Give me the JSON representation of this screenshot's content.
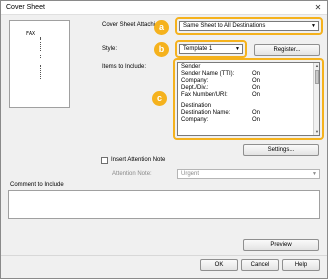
{
  "window": {
    "title": "Cover Sheet",
    "close_glyph": "✕"
  },
  "preview": {
    "fax_text": "FAX"
  },
  "cover_sheet_attachment": {
    "label": "Cover Sheet Attachi",
    "value": "Same Sheet to All Destinations"
  },
  "style": {
    "label": "Style:",
    "value": "Template 1",
    "register_label": "Register..."
  },
  "items_to_include": {
    "label": "Items to Include:",
    "rows": [
      {
        "name": "Sender",
        "value": ""
      },
      {
        "name": "Sender Name (TTI):",
        "value": "On"
      },
      {
        "name": "Company:",
        "value": "On"
      },
      {
        "name": "Dept./Div.:",
        "value": "On"
      },
      {
        "name": "Fax Number/URI:",
        "value": "On"
      },
      {
        "name": "",
        "value": ""
      },
      {
        "name": "Destination",
        "value": ""
      },
      {
        "name": "Destination Name:",
        "value": "On"
      },
      {
        "name": "Company:",
        "value": "On"
      }
    ],
    "settings_label": "Settings..."
  },
  "attention_note": {
    "checkbox_label": "Insert Attention Note",
    "field_label": "Attention Note:",
    "value": "Urgent"
  },
  "comment": {
    "label": "Comment to Include"
  },
  "callouts": {
    "a": "a",
    "b": "b",
    "c": "c"
  },
  "colors": {
    "callout": "#f5b21d"
  },
  "footer": {
    "preview_label": "Preview",
    "ok_label": "OK",
    "cancel_label": "Cancel",
    "help_label": "Help"
  }
}
